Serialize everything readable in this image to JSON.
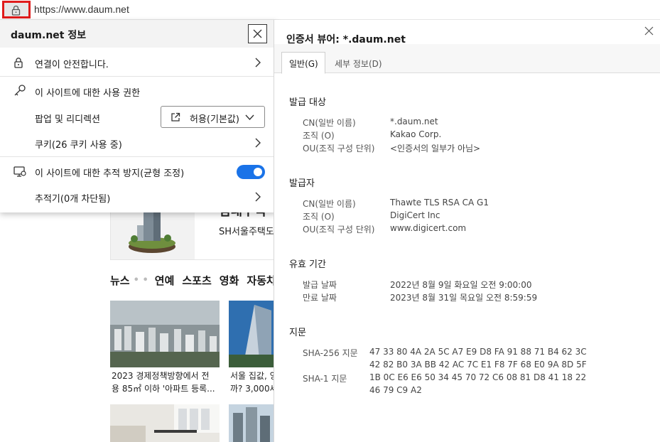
{
  "address_bar": {
    "url": "https://www.daum.net"
  },
  "background_page": {
    "promo_title": "임대주택",
    "promo_subtitle": "SH서울주택도",
    "news_tabs": [
      "뉴스",
      "연예",
      "스포츠",
      "영화",
      "자동차"
    ],
    "news_items": [
      {
        "caption_line1": "2023 경제정책방향에서 전",
        "caption_line2": "용 85㎡ 이하 '아파트 등록..."
      },
      {
        "caption_line1": "서울 집값, 잉",
        "caption_line2": "까? 3,000세"
      }
    ]
  },
  "site_info": {
    "title": "daum.net 정보",
    "connection": "연결이 안전합니다.",
    "permissions_heading": "이 사이트에 대한 사용 권한",
    "popup_label": "팝업 및 리디렉션",
    "popup_value": "허용(기본값)",
    "cookies": "쿠키(26 쿠키 사용 중)",
    "tracking_heading": "이 사이트에 대한 추적 방지(균형 조정)",
    "tracking_enabled": true,
    "trackers": "추적기(0개 차단됨)",
    "accent_color": "#1a73e8"
  },
  "certificate": {
    "title": "인증서 뷰어: *.daum.net",
    "tabs": [
      "일반(G)",
      "세부 정보(D)"
    ],
    "issued_to": {
      "heading": "발급 대상",
      "rows": [
        {
          "label": "CN(일반 이름)",
          "value": "*.daum.net"
        },
        {
          "label": "조직 (O)",
          "value": "Kakao Corp."
        },
        {
          "label": "OU(조직 구성 단위)",
          "value": "<인증서의 일부가 아님>"
        }
      ]
    },
    "issued_by": {
      "heading": "발급자",
      "rows": [
        {
          "label": "CN(일반 이름)",
          "value": "Thawte TLS RSA CA G1"
        },
        {
          "label": "조직 (O)",
          "value": "DigiCert Inc"
        },
        {
          "label": "OU(조직 구성 단위)",
          "value": "www.digicert.com"
        }
      ]
    },
    "validity": {
      "heading": "유효 기간",
      "rows": [
        {
          "label": "발급 날짜",
          "value": "2022년 8월 9일 화요일 오전 9:00:00"
        },
        {
          "label": "만료 날짜",
          "value": "2023년 8월 31일 목요일 오전 8:59:59"
        }
      ]
    },
    "fingerprints": {
      "heading": "지문",
      "sha256_label": "SHA-256 지문",
      "sha256_line1": "47 33 80 4A 2A 5C A7 E9 D8 FA 91 88 71 B4 62 3C",
      "sha256_line2": "42 82 B0 3A BB 42 AC 7C E1 F8 7F 68 E0 9A 8D 5F",
      "sha1_label": "SHA-1 지문",
      "sha1_line1": "1B 0C E6 E6 50 34 45 70 72 C6 08 81 D8 41 18 22",
      "sha1_line2": "46 79 C9 A2"
    }
  }
}
